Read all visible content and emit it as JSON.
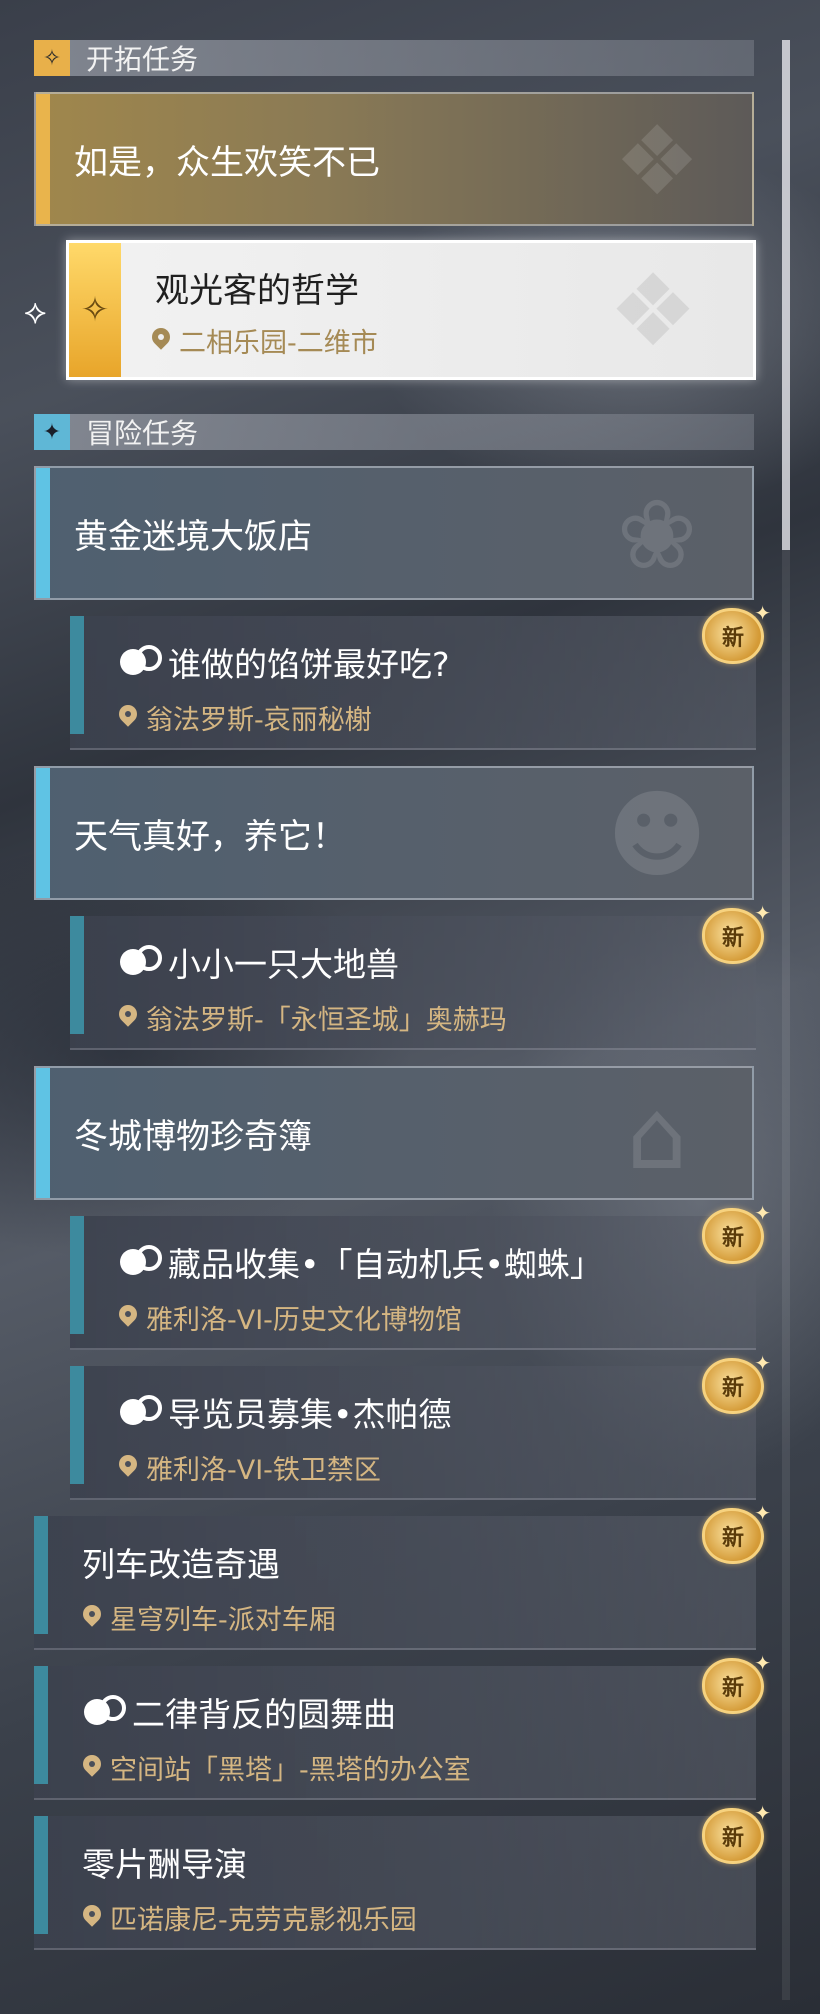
{
  "sections": {
    "trailblaze": {
      "title": "开拓任务",
      "icon": "trailblaze-icon"
    },
    "adventure": {
      "title": "冒险任务",
      "icon": "adventure-icon"
    }
  },
  "trailblaze_group": {
    "label": "如是，众生欢笑不已"
  },
  "selected_quest": {
    "title": "观光客的哲学",
    "location": "二相乐园-二维市"
  },
  "groups": [
    {
      "label": "黄金迷境大饭店"
    },
    {
      "label": "天气真好，养它！"
    },
    {
      "label": "冬城博物珍奇簿"
    }
  ],
  "quests": [
    {
      "title": "谁做的馅饼最好吃?",
      "location": "翁法罗斯-哀丽秘榭",
      "badge": "新"
    },
    {
      "title": "小小一只大地兽",
      "location": "翁法罗斯-「永恒圣城」奥赫玛",
      "badge": "新"
    },
    {
      "title": "藏品收集•「自动机兵•蜘蛛」",
      "location": "雅利洛-VI-历史文化博物馆",
      "badge": "新"
    },
    {
      "title": "导览员募集•杰帕德",
      "location": "雅利洛-VI-铁卫禁区",
      "badge": "新"
    },
    {
      "title": "列车改造奇遇",
      "location": "星穹列车-派对车厢",
      "badge": "新"
    },
    {
      "title": "二律背反的圆舞曲",
      "location": "空间站「黑塔」-黑塔的办公室",
      "badge": "新"
    },
    {
      "title": "零片酬导演",
      "location": "匹诺康尼-克劳克影视乐园",
      "badge": "新"
    }
  ],
  "colors": {
    "trailblaze_accent": "#e9b44c",
    "adventure_accent": "#5fc3e4",
    "location_text": "#d5b682",
    "quest_bar": "#3d8a9e"
  }
}
